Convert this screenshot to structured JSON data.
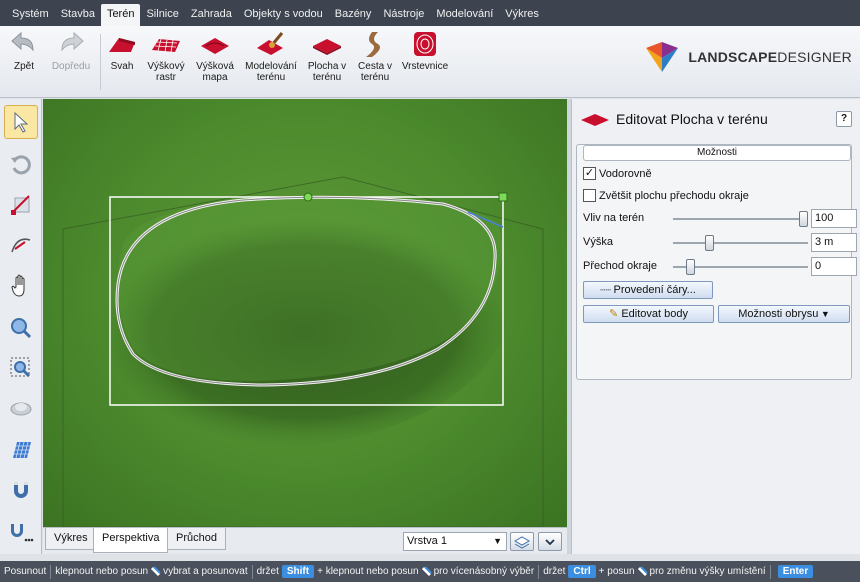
{
  "menu": {
    "items": [
      "Systém",
      "Stavba",
      "Terén",
      "Silnice",
      "Zahrada",
      "Objekty s vodou",
      "Bazény",
      "Nástroje",
      "Modelování",
      "Výkres"
    ],
    "active": "Terén"
  },
  "ribbon": {
    "back": "Zpět",
    "forward": "Dopředu",
    "tools": [
      {
        "line1": "Svah",
        "line2": ""
      },
      {
        "line1": "Výškový",
        "line2": "rastr"
      },
      {
        "line1": "Výšková",
        "line2": "mapa"
      },
      {
        "line1": "Modelování",
        "line2": "terénu"
      },
      {
        "line1": "Plocha v",
        "line2": "terénu"
      },
      {
        "line1": "Cesta v",
        "line2": "terénu"
      },
      {
        "line1": "Vrstevnice",
        "line2": ""
      }
    ]
  },
  "logo": {
    "bold": "LANDSCAPE",
    "light": "DESIGNER"
  },
  "toolbar_icons": [
    "select-arrow-icon",
    "rotate-icon",
    "resize-icon",
    "curve-edit-icon",
    "pan-hand-icon",
    "zoom-icon",
    "zoom-region-icon",
    "orbit-icon",
    "grid-icon",
    "magnet-icon",
    "snap-options-icon"
  ],
  "tabs": {
    "items": [
      "Výkres",
      "Perspektiva",
      "Průchod"
    ],
    "active": "Perspektiva"
  },
  "layer": {
    "value": "Vrstva 1"
  },
  "panel": {
    "title": "Editovat Plocha v terénu",
    "help": "?",
    "options_header": "Možnosti",
    "check_horizontal": {
      "label": "Vodorovně",
      "checked": true
    },
    "check_enlarge": {
      "label": "Zvětšit plochu přechodu okraje",
      "checked": false
    },
    "sliders": [
      {
        "label": "Vliv na terén",
        "value": "100",
        "level": 1.0
      },
      {
        "label": "Výška",
        "value": "3 m",
        "level": 0.25
      },
      {
        "label": "Přechod okraje",
        "value": "0",
        "level": 0.1
      }
    ],
    "line_button": "Provedení čáry...",
    "edit_points": "Editovat body",
    "outline_options": "Možnosti obrysu"
  },
  "status": {
    "t1": "Posunout",
    "t2": "klepnout nebo posun",
    "t3": "vybrat a posunovat",
    "t4": "držet",
    "k1": "Shift",
    "t5": "+ klepnout nebo posun",
    "t6": "pro vícenásobný výběr",
    "t7": "držet",
    "k2": "Ctrl",
    "t8": "+ posun",
    "t9": "pro změnu výšky umístění",
    "k3": "Enter"
  },
  "colors": {
    "accent_red": "#c8102e",
    "menu_bg": "#3d4450",
    "status_bg": "#4a515c",
    "key_blue": "#3b8ee0",
    "grass": "#4c8a2d",
    "selection_handle": "#7ed957"
  }
}
